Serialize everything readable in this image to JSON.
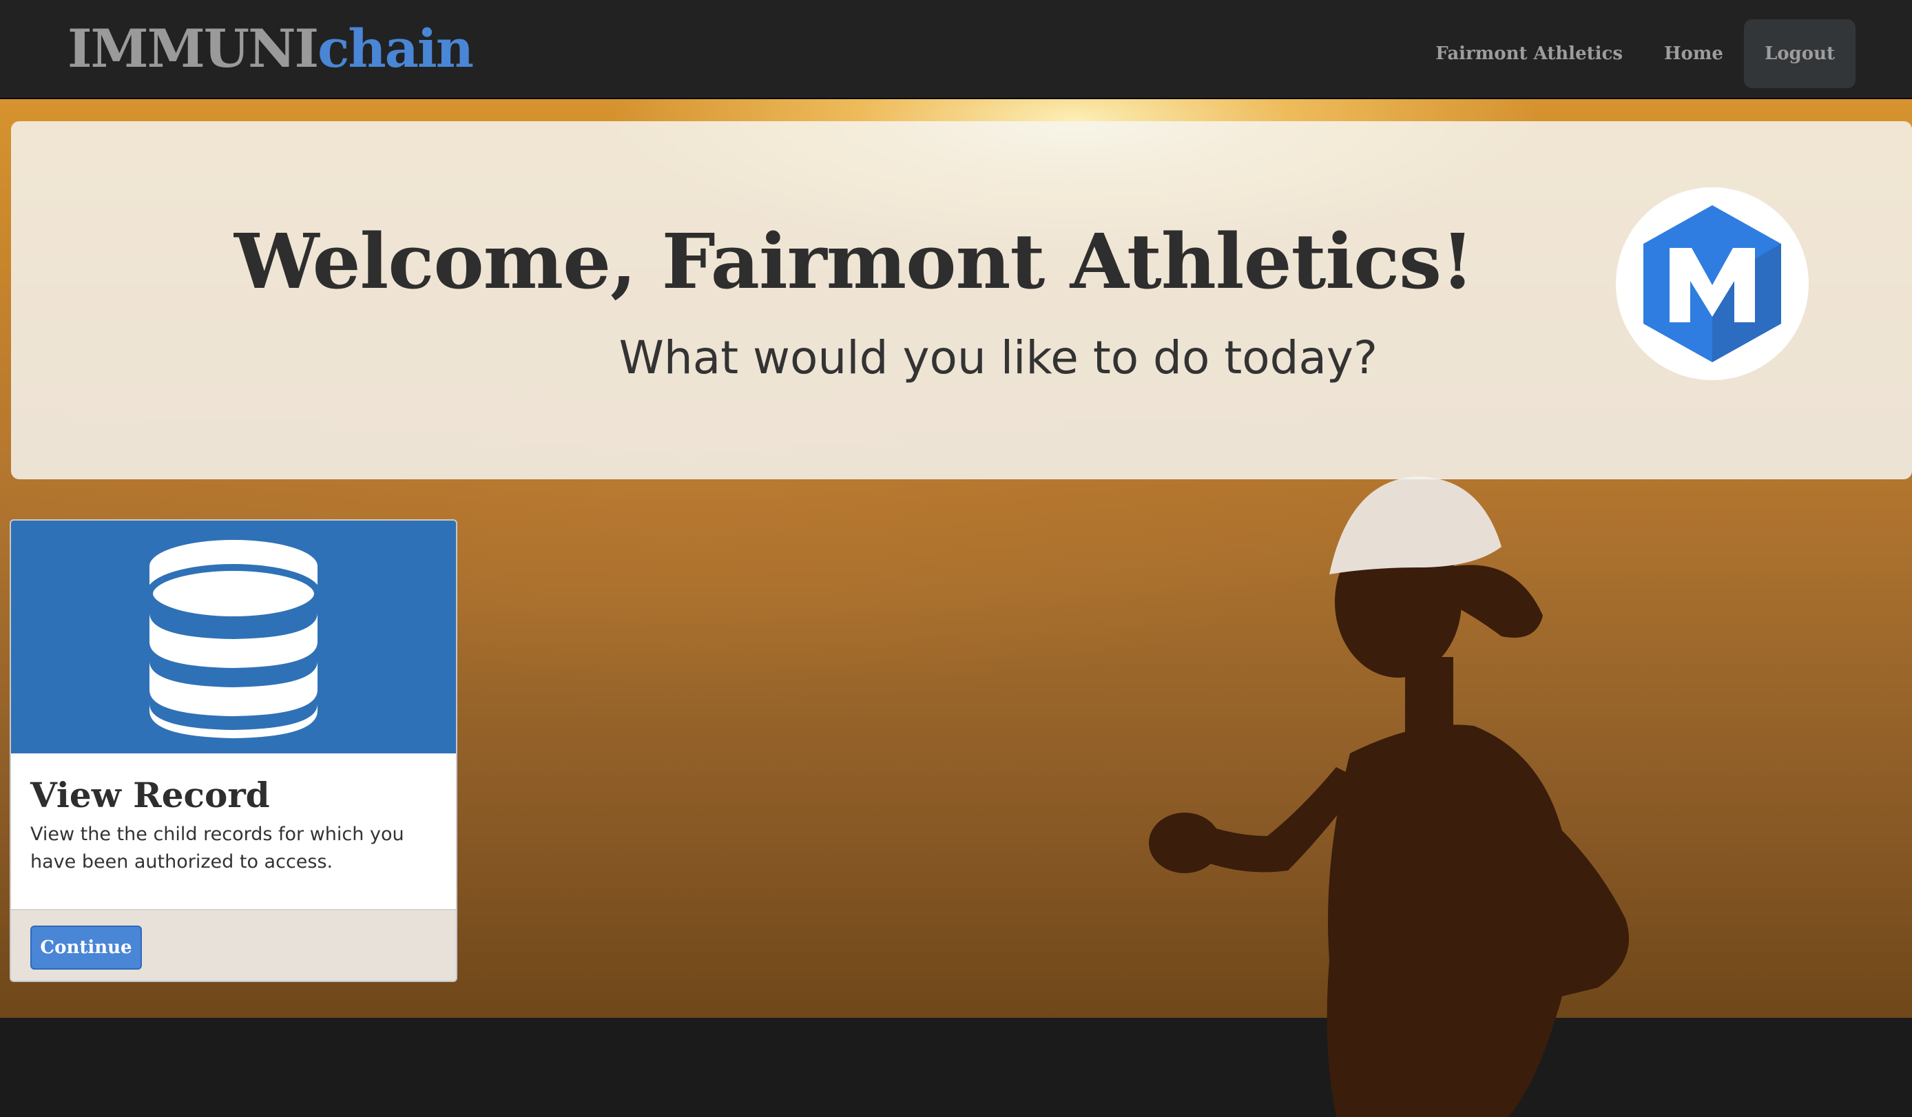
{
  "navbar": {
    "brand_prefix": "IMMUNI",
    "brand_suffix": "chain",
    "links": [
      {
        "label": "Fairmont Athletics"
      },
      {
        "label": "Home"
      },
      {
        "label": "Logout"
      }
    ]
  },
  "hero": {
    "title": "Welcome, Fairmont Athletics!",
    "subtitle": "What would you like to do today?",
    "logo_icon": "hexagon-m-logo-icon"
  },
  "card": {
    "icon": "database-icon",
    "title": "View Record",
    "text": "View the the child records for which you have been authorized to access.",
    "button_label": "Continue"
  },
  "colors": {
    "navbar_bg": "#222222",
    "brand_gray": "#9a9a9a",
    "brand_blue": "#4a86d6",
    "card_header_blue": "#2f71b6",
    "button_blue": "#4a86d6",
    "logo_blue": "#2f7de1"
  }
}
